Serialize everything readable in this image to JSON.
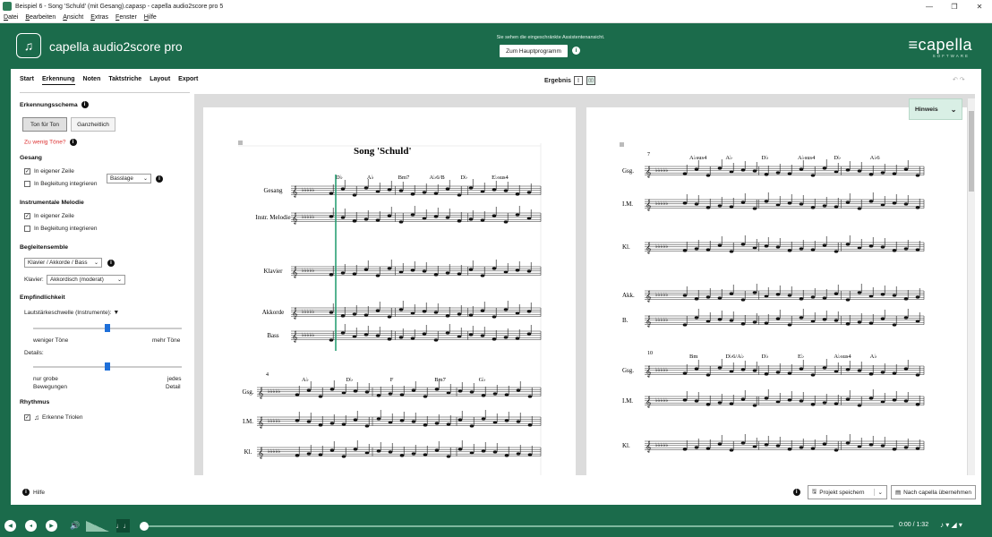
{
  "window": {
    "title": "Beispiel 6 - Song 'Schuld' (mit Gesang).capasp - capella audio2score pro 5",
    "controls": [
      "—",
      "❐",
      "✕"
    ]
  },
  "menu": [
    "Datei",
    "Bearbeiten",
    "Ansicht",
    "Extras",
    "Fenster",
    "Hilfe"
  ],
  "header": {
    "app_name": "capella audio2score pro",
    "notice": "Sie sehen die eingeschränkte Assistentenansicht.",
    "main_button": "Zum Hauptprogramm",
    "brand": "≡capella",
    "brand_sub": "SOFTWARE"
  },
  "tabs": [
    "Start",
    "Erkennung",
    "Noten",
    "Taktstriche",
    "Layout",
    "Export"
  ],
  "sidebar": {
    "schema_title": "Erkennungsschema",
    "btn_ton": "Ton für Ton",
    "btn_ganz": "Ganzheitlich",
    "too_few": "Zu wenig Töne?",
    "gesang_title": "Gesang",
    "gesang_own": "In eigener Zeile",
    "gesang_acc": "In Begleitung integrieren",
    "bass_select": "Basslage",
    "melodie_title": "Instrumentale Melodie",
    "melodie_own": "In eigener Zeile",
    "melodie_acc": "In Begleitung integrieren",
    "ensemble_title": "Begleitensemble",
    "ensemble_select": "Klavier / Akkorde / Bass",
    "klavier_label": "Klavier:",
    "klavier_select": "Akkordisch (moderat)",
    "empf_title": "Empfindlichkeit",
    "laut_label": "Lautstärkeschwelle (Instrumente):",
    "laut_value": 0.5,
    "less_tones": "weniger Töne",
    "more_tones": "mehr Töne",
    "details_label": "Details:",
    "details_value": 0.5,
    "coarse1": "nur grobe",
    "coarse2": "Bewegungen",
    "every1": "jedes",
    "every2": "Detail",
    "rhythm_title": "Rhythmus",
    "triolen": "Erkenne Triolen",
    "help": "Hilfe"
  },
  "score": {
    "ergebnis": "Ergebnis",
    "hinweis": "Hinweis",
    "title": "Song 'Schuld'",
    "sys1_labels": [
      "Gesang",
      "Instr. Melodie",
      "Klavier",
      "Akkorde",
      "Bass"
    ],
    "sys1_chords": [
      "D♭",
      "A♭",
      "Bm7",
      "A♭6/B",
      "D♭",
      "E♭sus4"
    ],
    "sys2_measure": "4",
    "sys2_labels": [
      "Gsg.",
      "I.M.",
      "Kl."
    ],
    "sys2_chords": [
      "A♭",
      "D♭",
      "F",
      "Bm7",
      "G♭"
    ],
    "p2_measure1": "7",
    "p2_chords1": [
      "A♭sus4",
      "A♭",
      "D♭",
      "A♭sus4",
      "D♭",
      "A♭6"
    ],
    "p2_labels1": [
      "Gsg.",
      "I.M.",
      "Kl.",
      "Akk.",
      "B."
    ],
    "p2_measure2": "10",
    "p2_chords2": [
      "Bm",
      "D♭6/A♭",
      "D♭",
      "E♭",
      "A♭sus4",
      "A♭"
    ],
    "p2_labels2": [
      "Gsg.",
      "I.M.",
      "Kl."
    ]
  },
  "footer": {
    "save": "Projekt speichern",
    "transfer": "Nach capella übernehmen"
  },
  "transport": {
    "time": "0:00 / 1:32",
    "progress": 0.0
  },
  "colors": {
    "brand_green": "#1b6b4b",
    "playhead": "#1d9a6c",
    "warning_red": "#d33"
  }
}
